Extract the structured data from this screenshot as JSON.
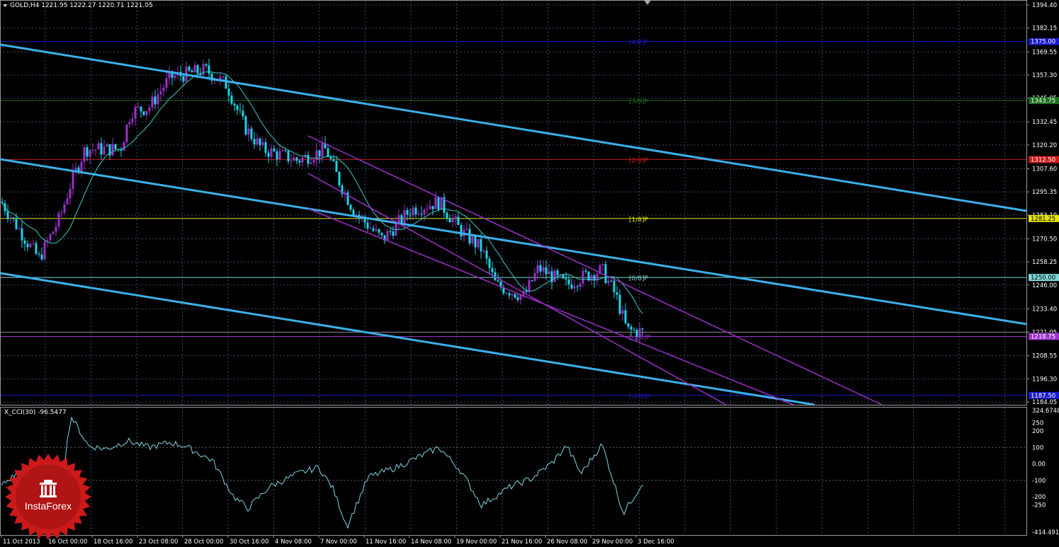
{
  "window": {
    "symbol_label": "GOLD,H4",
    "ohlc": "1221.95 1222.27 1220.71 1221.05",
    "menu_icon": "dropdown-arrow-icon"
  },
  "indicator": {
    "name": "X_CCI(30)",
    "value": "-96.5477",
    "axis_labels": [
      "324.6748",
      "250",
      "200",
      "100",
      "0.00",
      "-100",
      "-200",
      "-250",
      "-414.4914"
    ]
  },
  "price_axis": {
    "labels": [
      "1394.40",
      "1382.15",
      "1369.55",
      "1357.30",
      "1345.05",
      "1332.45",
      "1320.20",
      "1307.60",
      "1295.35",
      "1283.10",
      "1270.50",
      "1258.25",
      "1246.00",
      "1233.40",
      "1221.05",
      "1208.55",
      "1196.30",
      "1184.05"
    ],
    "current_price": "1221.05"
  },
  "murrey_levels": [
    {
      "label": "[4/8]P",
      "price": 1375.0,
      "tag": "1375.00",
      "color": "#1a1acc"
    },
    {
      "label": "[3/8]P",
      "price": 1343.75,
      "tag": "1343.75",
      "color": "#1f6e1f"
    },
    {
      "label": "[2/8]P",
      "price": 1312.5,
      "tag": "1312.50",
      "color": "#cc1a1a"
    },
    {
      "label": "[1/8]P",
      "price": 1281.25,
      "tag": "1281.25",
      "color": "#e6e600"
    },
    {
      "label": "[0/8]P",
      "price": 1250.0,
      "tag": "1250.00",
      "color": "#7fd6d6"
    },
    {
      "label": "[-1/8]P",
      "price": 1218.75,
      "tag": "1218.75",
      "color": "#9933cc"
    },
    {
      "label": "[-2/8]P",
      "price": 1187.5,
      "tag": "1187.50",
      "color": "#1a1acc"
    }
  ],
  "time_axis": {
    "labels": [
      "11 Oct 2013",
      "16 Oct 00:00",
      "18 Oct 16:00",
      "23 Oct 08:00",
      "28 Oct 00:00",
      "30 Oct 16:00",
      "4 Nov 08:00",
      "7 Nov 00:00",
      "11 Nov 16:00",
      "14 Nov 08:00",
      "19 Nov 00:00",
      "21 Nov 16:00",
      "26 Nov 08:00",
      "29 Nov 00:00",
      "3 Dec 16:00"
    ]
  },
  "branding": {
    "logo_text": "InstaForex"
  },
  "colors": {
    "background": "#000000",
    "bull_candle": "#9b30c8",
    "bear_candle": "#1fd4e8",
    "ma_line": "#3cc8c8",
    "channel_blue": "#3bb0ea",
    "channel_purple": "#9b30c8",
    "grid": "#3a4a6a",
    "cci_line": "#7fd6e6",
    "logo_red": "#cc1a1a"
  }
}
